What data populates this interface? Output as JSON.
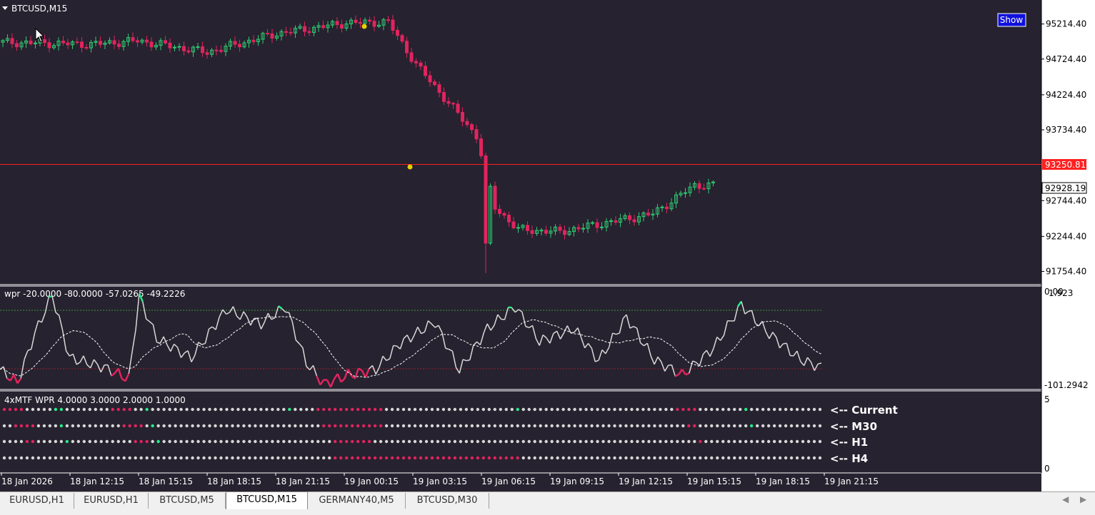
{
  "chart": {
    "symbol_label": "BTCUSD,M15",
    "show_button": "Show",
    "price_axis": [
      "95214.40",
      "94724.40",
      "94224.40",
      "93734.40",
      "92744.40",
      "92244.40",
      "91754.40"
    ],
    "price_range": [
      91600,
      95500
    ],
    "red_line_price": 93250.81,
    "red_line_label": "93250.81",
    "current_price_label": "92928.19",
    "current_price": 92928.19,
    "time_labels": [
      "18 Jan 2026",
      "18 Jan 12:15",
      "18 Jan 15:15",
      "18 Jan 18:15",
      "18 Jan 21:15",
      "19 Jan 00:15",
      "19 Jan 03:15",
      "19 Jan 06:15",
      "19 Jan 09:15",
      "19 Jan 12:15",
      "19 Jan 15:15",
      "19 Jan 18:15",
      "19 Jan 21:15"
    ],
    "colors": {
      "background": "#26222f",
      "bull": "#2ecc71",
      "bear": "#e0245e",
      "grid": "#ffffff",
      "upper_level": "#3a9a3a",
      "lower_level": "#9a2030"
    }
  },
  "wpr_panel": {
    "label": "wpr  -20.0000 -80.0000 -57.0265 -49.2226",
    "axis_top": "1.923",
    "axis_top_overlap": "0.00",
    "axis_bottom": "-101.2942",
    "range": [
      -101.2942,
      1.923
    ],
    "levels": [
      -20,
      -80
    ]
  },
  "mtf_panel": {
    "label": "4xMTF WPR  4.0000 3.0000 2.0000 1.0000",
    "axis_top": "5",
    "axis_bottom": "0",
    "rows": [
      "<-- Current",
      "<-- M30",
      "<-- H1",
      "<-- H4"
    ]
  },
  "tabs": [
    "EURUSD,H1",
    "EURUSD,H1",
    "BTCUSD,M5",
    "BTCUSD,M15",
    "GERMANY40,M5",
    "BTCUSD,M30"
  ],
  "active_tab_index": 3
}
